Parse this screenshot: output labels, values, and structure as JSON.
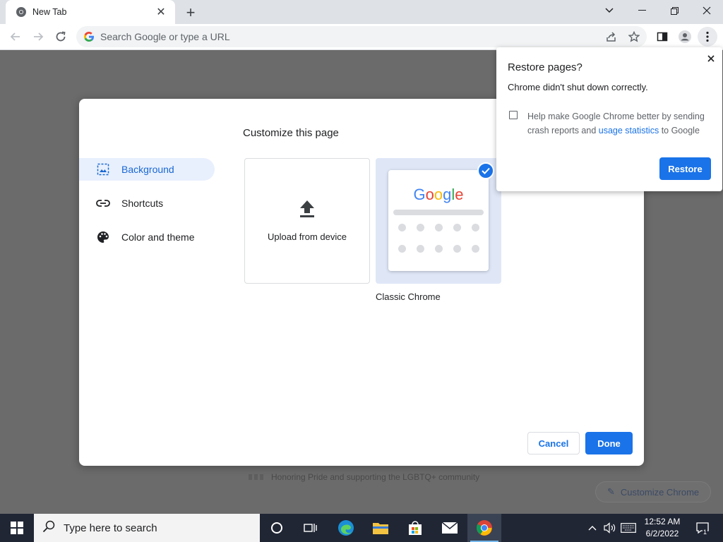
{
  "browser": {
    "tab_title": "New Tab",
    "omnibox_placeholder": "Search Google or type a URL"
  },
  "dialog": {
    "title": "Customize this page",
    "sidebar": [
      {
        "label": "Background",
        "icon": "image-icon",
        "active": true
      },
      {
        "label": "Shortcuts",
        "icon": "link-icon",
        "active": false
      },
      {
        "label": "Color and theme",
        "icon": "palette-icon",
        "active": false
      }
    ],
    "tiles": {
      "upload_label": "Upload from device",
      "classic_label": "Classic Chrome",
      "google_logo": [
        "G",
        "o",
        "o",
        "g",
        "l",
        "e"
      ]
    },
    "cancel_label": "Cancel",
    "done_label": "Done"
  },
  "restore_bubble": {
    "title": "Restore pages?",
    "message": "Chrome didn't shut down correctly.",
    "help_prefix": "Help make Google Chrome better by sending crash reports and ",
    "help_link": "usage statistics",
    "help_suffix": " to Google",
    "restore_label": "Restore"
  },
  "page": {
    "banner_text": "Honoring Pride and supporting the LGBTQ+ community",
    "customize_chrome_label": "Customize Chrome"
  },
  "taskbar": {
    "search_placeholder": "Type here to search",
    "time": "12:52 AM",
    "date": "6/2/2022",
    "notification_count": "1"
  },
  "colors": {
    "accent": "#1a73e8",
    "google_blue": "#4285f4",
    "google_red": "#ea4335",
    "google_yellow": "#fbbc05",
    "google_green": "#34a853",
    "taskbar": "#202634"
  }
}
